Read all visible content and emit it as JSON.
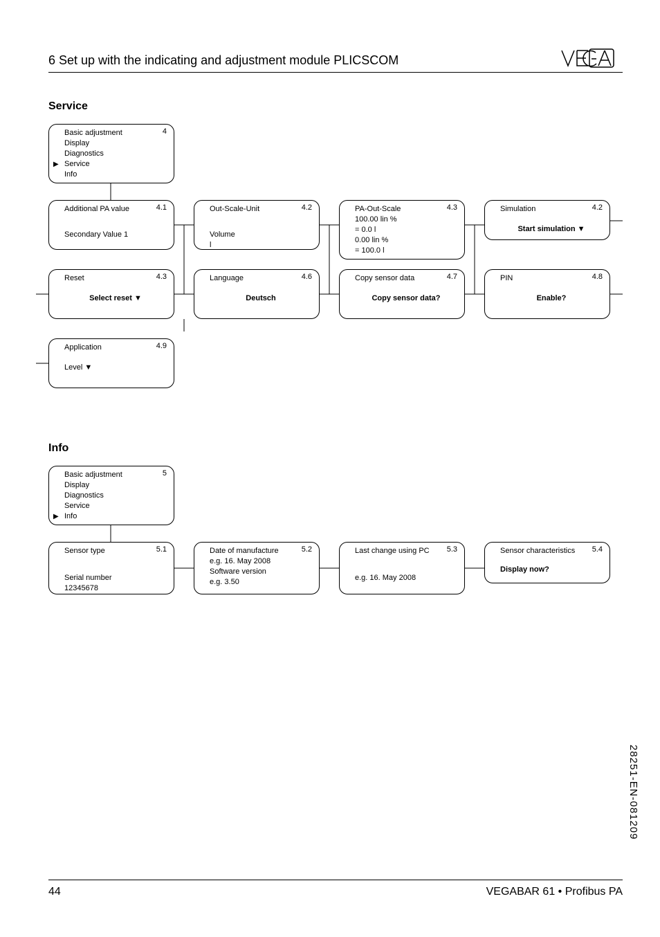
{
  "header": {
    "title": "6   Set up with the indicating and adjustment module PLICSCOM"
  },
  "section1": {
    "title": "Service"
  },
  "section2": {
    "title": "Info"
  },
  "menu1": {
    "num": "4",
    "items": [
      "Basic adjustment",
      "Display",
      "Diagnostics",
      "Service",
      "Info"
    ],
    "selected_index": 3
  },
  "menu2": {
    "num": "5",
    "items": [
      "Basic adjustment",
      "Display",
      "Diagnostics",
      "Service",
      "Info"
    ],
    "selected_index": 4
  },
  "service": {
    "b41": {
      "num": "4.1",
      "t1": "Additional PA value",
      "t2": "Secondary Value 1"
    },
    "b42a": {
      "num": "4.2",
      "t1": "Out-Scale-Unit",
      "t2": "Volume",
      "t3": "l"
    },
    "b43a": {
      "num": "4.3",
      "t1": "PA-Out-Scale",
      "t2": "100.00 lin %",
      "t3": "= 0.0 l",
      "t4": "0.00 lin %",
      "t5": "= 100.0 l"
    },
    "b42b": {
      "num": "4.2",
      "t1": "Simulation",
      "t2": "Start simulation ▼"
    },
    "b43b": {
      "num": "4.3",
      "t1": "Reset",
      "t2": "Select reset ▼"
    },
    "b46": {
      "num": "4.6",
      "t1": "Language",
      "t2": "Deutsch"
    },
    "b47": {
      "num": "4.7",
      "t1": "Copy sensor data",
      "t2": "Copy sensor data?"
    },
    "b48": {
      "num": "4.8",
      "t1": "PIN",
      "t2": "Enable?"
    },
    "b49": {
      "num": "4.9",
      "t1": "Application",
      "t2": "Level ▼"
    }
  },
  "info": {
    "b51": {
      "num": "5.1",
      "t1": "Sensor type",
      "t2": "Serial number",
      "t3": "12345678"
    },
    "b52": {
      "num": "5.2",
      "t1": "Date of manufacture",
      "t2": "e.g. 16. May 2008",
      "t3": "Software version",
      "t4": "e.g. 3.50"
    },
    "b53": {
      "num": "5.3",
      "t1": "Last change using PC",
      "t2": "e.g. 16. May 2008"
    },
    "b54": {
      "num": "5.4",
      "t1": "Sensor characteristics",
      "t2": "Display now?"
    }
  },
  "footer": {
    "page": "44",
    "doc": "VEGABAR 61 • Proﬁbus PA"
  },
  "sidecode": "28251-EN-081209"
}
